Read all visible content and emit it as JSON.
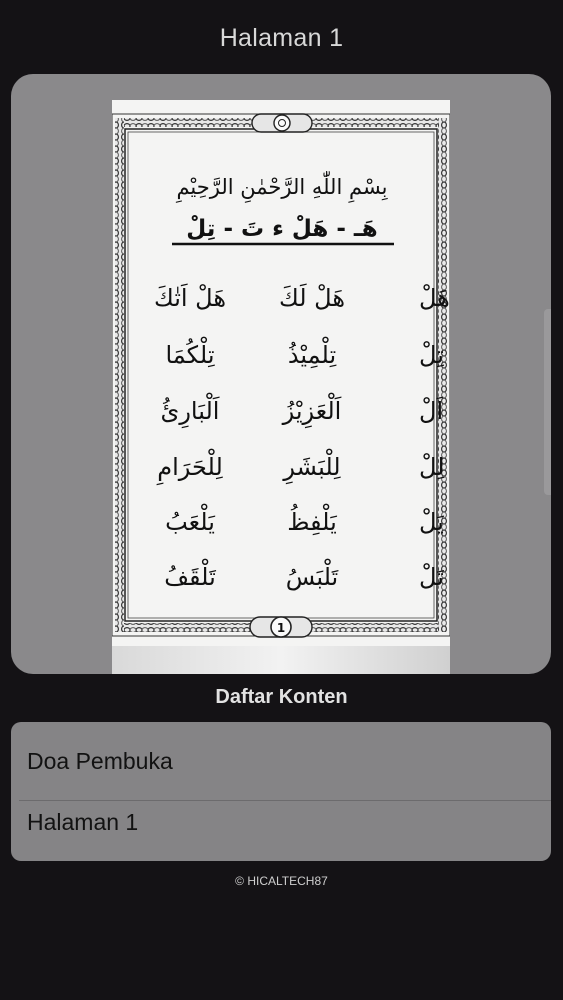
{
  "header": {
    "title": "Halaman 1"
  },
  "page": {
    "bismillah": "بِسْمِ اللّٰهِ الرَّحْمٰنِ الرَّحِيْمِ",
    "heading": "هَـ - هَلْ ء تَ - تِلْ",
    "rows": [
      {
        "col1": "هَـ - هَلْ",
        "col2": "هَلْ لَكَ",
        "col3": "هَلْ اَتٰكَ"
      },
      {
        "col1": "تِ - تِلْ",
        "col2": "تِلْمِيْذُ",
        "col3": "تِلْكُمَا"
      },
      {
        "col1": "اَ - اَلْ",
        "col2": "اَلْعَزِيْزُ",
        "col3": "اَلْبَارِئُ"
      },
      {
        "col1": "لِ - لِلْ",
        "col2": "لِلْبَشَرِ",
        "col3": "لِلْحَرَامِ"
      },
      {
        "col1": "يَ - يَلْ",
        "col2": "يَلْفِظُ",
        "col3": "يَلْعَبُ"
      },
      {
        "col1": "تَ - تَلْ",
        "col2": "تَلْبَسُ",
        "col3": "تَلْقَفُ"
      }
    ],
    "page_number": "1"
  },
  "section": {
    "title": "Daftar Konten"
  },
  "content_list": [
    {
      "label": "Doa Pembuka"
    },
    {
      "label": "Halaman 1"
    }
  ],
  "footer": {
    "copyright": "© HICALTECH87"
  },
  "colors": {
    "background": "#141215",
    "card": "#8a898b",
    "list_card": "#858486",
    "page_paper": "#f4f4f3",
    "ink": "#111111"
  }
}
